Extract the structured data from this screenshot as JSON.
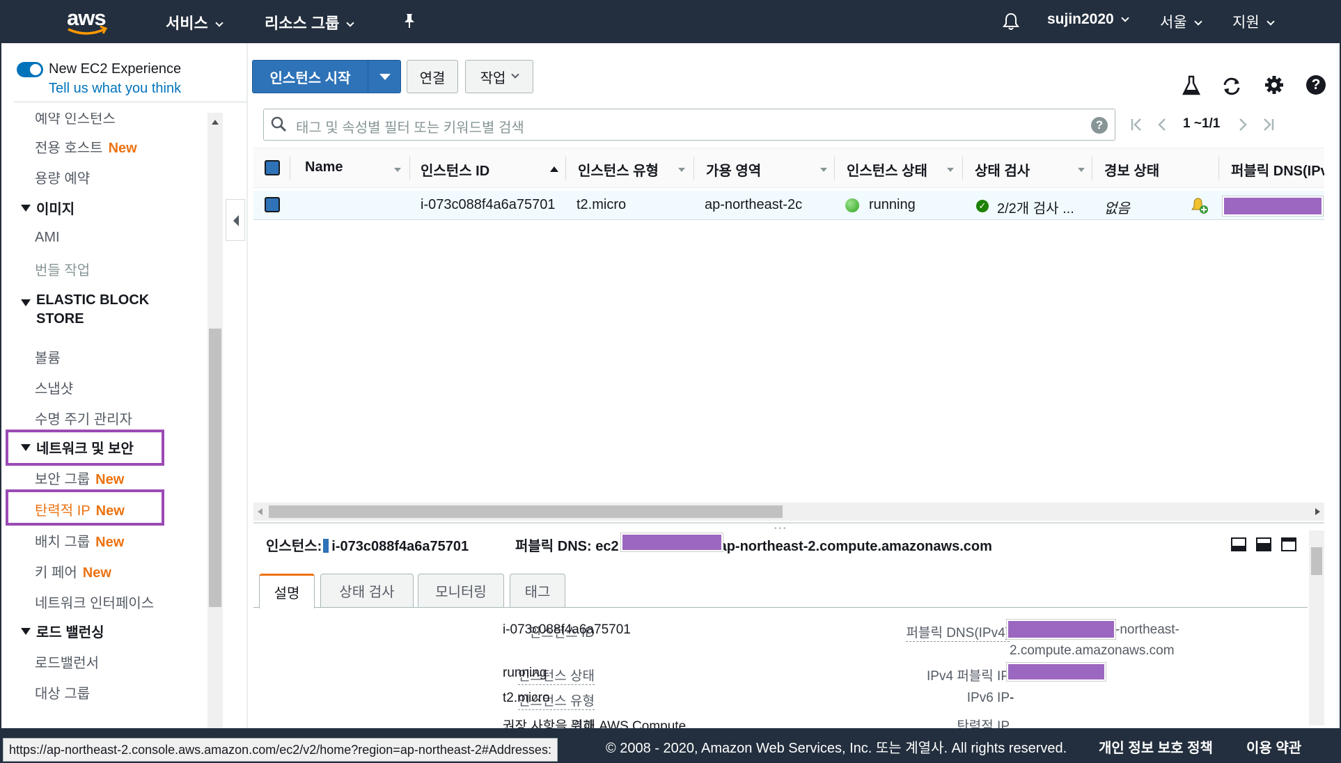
{
  "topnav": {
    "logo": "aws",
    "services": "서비스",
    "resource_groups": "리소스 그룹",
    "user": "sujin2020",
    "region": "서울",
    "support": "지원"
  },
  "sidebar": {
    "experience_title": "New EC2 Experience",
    "experience_link": "Tell us what you think",
    "new_badge": "New",
    "items_top": [
      {
        "label": "예약 인스턴스",
        "new": false
      },
      {
        "label": "전용 호스트",
        "new": true
      },
      {
        "label": "용량 예약",
        "new": false
      }
    ],
    "sections": [
      {
        "title": "이미지",
        "items": [
          "AMI",
          "번들 작업"
        ]
      },
      {
        "title": "ELASTIC BLOCK STORE",
        "items": [
          "볼륨",
          "스냅샷",
          "수명 주기 관리자"
        ]
      },
      {
        "title": "네트워크 및 보안",
        "items": [
          "보안 그룹",
          "탄력적 IP",
          "배치 그룹",
          "키 페어",
          "네트워크 인터페이스"
        ]
      },
      {
        "title": "로드 밸런싱",
        "items": [
          "로드밸런서",
          "대상 그룹"
        ]
      }
    ]
  },
  "toolbar": {
    "launch": "인스턴스 시작",
    "connect": "연결",
    "actions": "작업"
  },
  "search": {
    "placeholder": "태그 및 속성별 필터 또는 키워드별 검색",
    "pagination": "1 ~1/1"
  },
  "table": {
    "headers": [
      "Name",
      "인스턴스 ID",
      "인스턴스 유형",
      "가용 영역",
      "인스턴스 상태",
      "상태 검사",
      "경보 상태",
      "퍼블릭 DNS(IPv"
    ],
    "row": {
      "name": "",
      "instance_id": "i-073c088f4a6a75701",
      "type": "t2.micro",
      "zone": "ap-northeast-2c",
      "state": "running",
      "status_check": "2/2개 검사 ...",
      "alarm": "없음"
    }
  },
  "detail": {
    "instance_label": "인스턴스:",
    "instance_id": "i-073c088f4a6a75701",
    "dns_label": "퍼블릭 DNS: ec2",
    "dns_suffix": "ap-northeast-2.compute.amazonaws.com",
    "tabs": [
      "설명",
      "상태 검사",
      "모니터링",
      "태그"
    ],
    "fields_left": [
      {
        "k": "인스턴스 ID",
        "v": "i-073c088f4a6a75701"
      },
      {
        "k": "인스턴스 상태",
        "v": "running"
      },
      {
        "k": "인스턴스 유형",
        "v": "t2.micro"
      },
      {
        "k": "결과",
        "v": "권장 사항을 위해 AWS Compute"
      }
    ],
    "fields_right": [
      {
        "k": "퍼블릭 DNS(IPv4)",
        "v1": "-northeast-",
        "v2": "2.compute.amazonaws.com"
      },
      {
        "k": "IPv4 퍼블릭 IP",
        "v": ""
      },
      {
        "k": "IPv6 IP",
        "v": "-"
      },
      {
        "k": "탄력적 IP",
        "v": ""
      }
    ]
  },
  "footer": {
    "status_url": "https://ap-northeast-2.console.aws.amazon.com/ec2/v2/home?region=ap-northeast-2#Addresses:",
    "copyright": "© 2008 - 2020, Amazon Web Services, Inc. 또는 계열사. All rights reserved.",
    "privacy": "개인 정보 보호 정책",
    "terms": "이용 약관"
  },
  "colors": {
    "nav_bg": "#232f3e",
    "primary": "#2e73b8",
    "new_badge": "#ec7211",
    "highlight": "#9b4bb4",
    "redaction": "#9b67c0",
    "running": "#2ea31c"
  },
  "icons": [
    "bell-icon",
    "pin-icon",
    "flask-icon",
    "refresh-icon",
    "gear-icon",
    "help-icon",
    "search-icon",
    "alarm-add-icon"
  ]
}
